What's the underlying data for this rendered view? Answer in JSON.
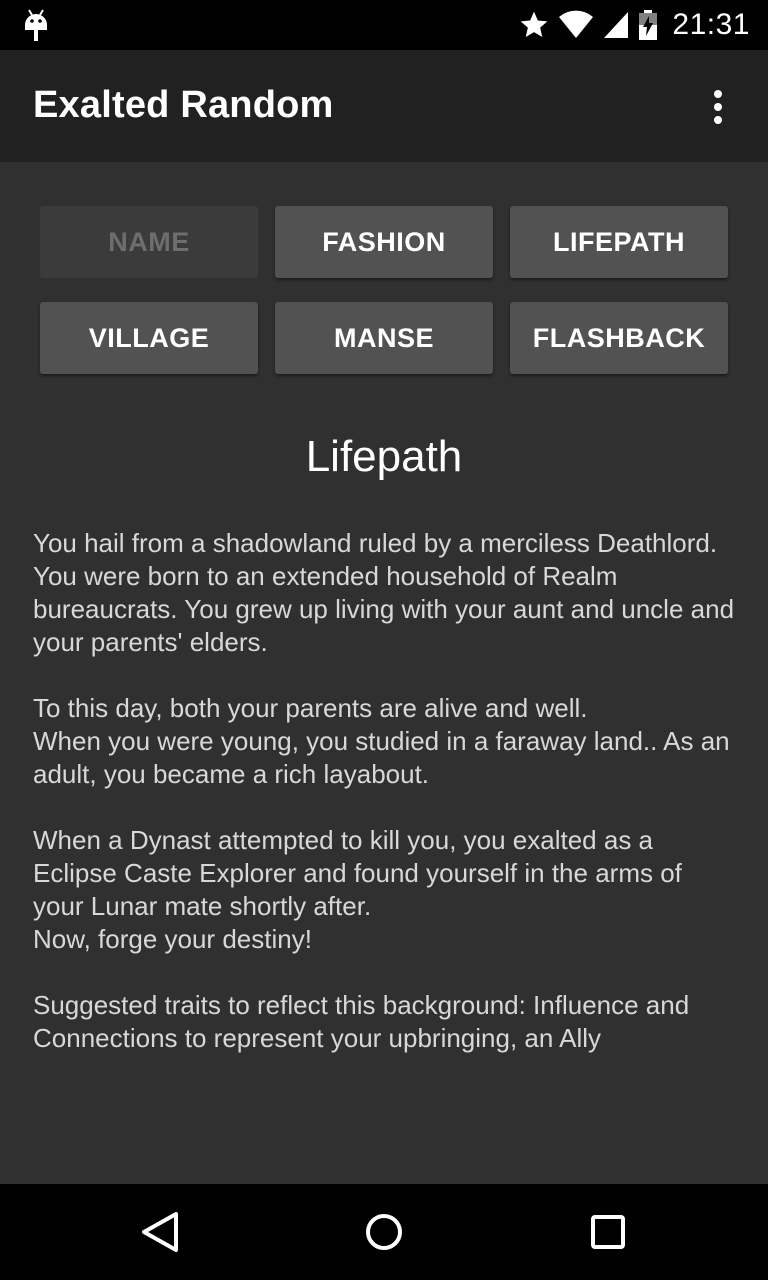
{
  "status_bar": {
    "time": "21:31",
    "icons": [
      "android-debug-icon",
      "star-icon",
      "wifi-icon",
      "signal-icon",
      "battery-charging-icon"
    ]
  },
  "app_bar": {
    "title": "Exalted Random",
    "menu_icon": "overflow-menu-icon"
  },
  "buttons": [
    {
      "label": "NAME",
      "enabled": false
    },
    {
      "label": "FASHION",
      "enabled": true
    },
    {
      "label": "LIFEPATH",
      "enabled": true
    },
    {
      "label": "VILLAGE",
      "enabled": true
    },
    {
      "label": "MANSE",
      "enabled": true
    },
    {
      "label": "FLASHBACK",
      "enabled": true
    }
  ],
  "content": {
    "heading": "Lifepath",
    "paragraphs": [
      "You hail from a shadowland ruled by a merciless Deathlord. You were born to an extended household of Realm bureaucrats. You grew up living with your aunt and uncle and your parents' elders.",
      "To this day, both your parents are alive and well.\nWhen you were young, you studied in a faraway land.. As an adult, you became a rich layabout.",
      "When a Dynast attempted to kill you, you exalted as a Eclipse Caste Explorer and found yourself in the arms of your Lunar mate shortly after.\nNow, forge your destiny!",
      "Suggested traits to reflect this background: Influence and Connections to represent your upbringing, an Ally"
    ]
  },
  "nav_bar": {
    "icons": [
      "back-icon",
      "home-icon",
      "recents-icon"
    ]
  },
  "colors": {
    "background": "#303030",
    "app_bar": "#212121",
    "button": "#525252",
    "button_disabled": "#3b3b3b",
    "text": "#d8d8d8"
  }
}
